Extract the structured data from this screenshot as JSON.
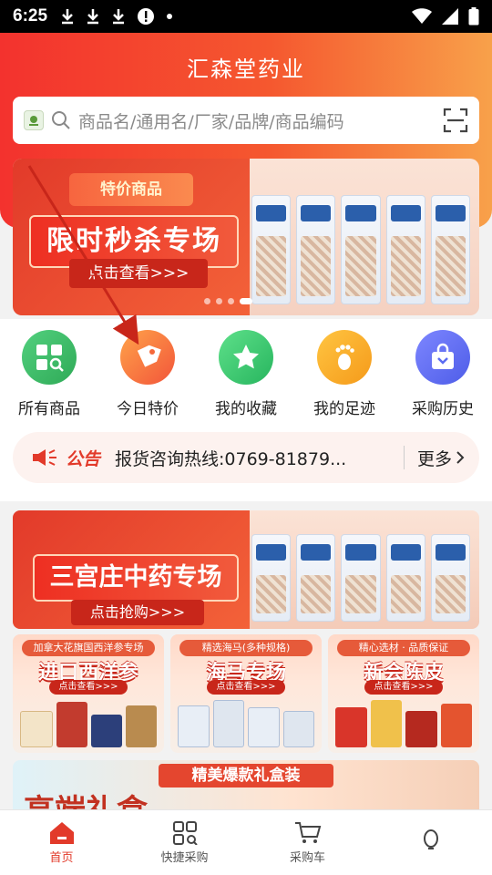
{
  "status_bar": {
    "time": "6:25"
  },
  "header": {
    "title": "汇森堂药业",
    "search_placeholder": "商品名/通用名/厂家/品牌/商品编码"
  },
  "banner": {
    "tag": "特价商品",
    "main": "限时秒杀专场",
    "cta": "点击查看>>>"
  },
  "quick_nav": [
    {
      "label": "所有商品",
      "icon": "grid-search-icon",
      "color": "#3fbf6a"
    },
    {
      "label": "今日特价",
      "icon": "price-tag-icon",
      "color": "#f5683a"
    },
    {
      "label": "我的收藏",
      "icon": "star-icon",
      "color": "#33c26a"
    },
    {
      "label": "我的足迹",
      "icon": "footprint-icon",
      "color": "#f7a224"
    },
    {
      "label": "采购历史",
      "icon": "shopping-bag-icon",
      "color": "#5b6cf2"
    }
  ],
  "notice": {
    "tag": "公告",
    "text": "报货咨询热线:0769-81879...",
    "more": "更多"
  },
  "zone_banner": {
    "main": "三宫庄中药专场",
    "cta": "点击抢购>>>"
  },
  "tiles": [
    {
      "top": "加拿大花旗国西洋参专场",
      "title": "进口西洋参",
      "cta": "点击查看>>>"
    },
    {
      "top": "精选海马(多种规格)",
      "title": "海马专场",
      "cta": "点击查看>>>"
    },
    {
      "top": "精心选材 · 品质保证",
      "title": "新会陈皮",
      "cta": "点击查看>>>"
    }
  ],
  "gift_banner": {
    "tag": "精美爆款礼盒装",
    "title": "高端礼盒"
  },
  "bottom_nav": [
    {
      "label": "首页",
      "icon": "home-icon",
      "active": true
    },
    {
      "label": "快捷采购",
      "icon": "quick-buy-icon",
      "active": false
    },
    {
      "label": "采购车",
      "icon": "cart-icon",
      "active": false
    },
    {
      "label": "",
      "icon": "profile-icon",
      "active": false
    }
  ],
  "colors": {
    "brand_red": "#e23a2a",
    "header_orange": "#f8a14a"
  }
}
